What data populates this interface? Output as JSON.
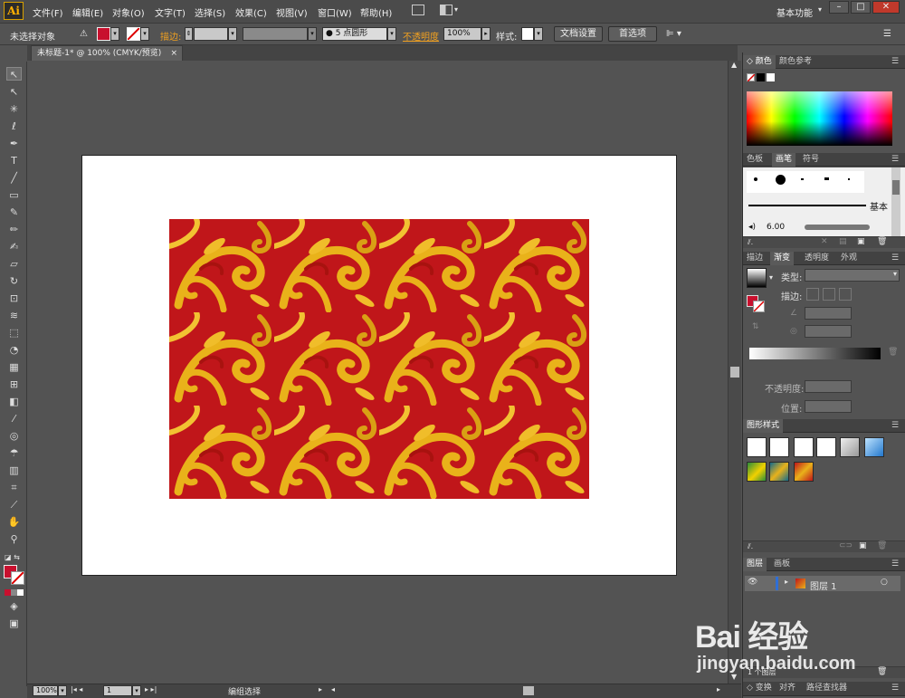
{
  "app": {
    "logo": "Ai",
    "workspace": "基本功能"
  },
  "menu": [
    "文件(F)",
    "编辑(E)",
    "对象(O)",
    "文字(T)",
    "选择(S)",
    "效果(C)",
    "视图(V)",
    "窗口(W)",
    "帮助(H)"
  ],
  "window_controls": {
    "minimize": "–",
    "maximize": "□",
    "close": "✕"
  },
  "control_bar": {
    "selection_status": "未选择对象",
    "stroke_label": "描边:",
    "brush_value": "5 点圆形",
    "opacity_label": "不透明度",
    "opacity_value": "100%",
    "style_label": "样式:",
    "doc_setup_button": "文档设置",
    "prefs_button": "首选项"
  },
  "document_tab": {
    "title": "未标题-1* @ 100% (CMYK/预览)",
    "close": "×"
  },
  "status_bar": {
    "zoom": "100%",
    "artboard_number": "1",
    "status_text": "编组选择"
  },
  "panels": {
    "color": {
      "tabs": [
        "颜色",
        "颜色参考"
      ]
    },
    "brushes": {
      "tabs": [
        "色板",
        "画笔",
        "符号"
      ],
      "basic_label": "基本",
      "brush_size": "6.00"
    },
    "gradient": {
      "tabs": [
        "描边",
        "渐变",
        "透明度",
        "外观"
      ],
      "type_label": "类型:",
      "stroke_label": "描边:",
      "opacity_label": "不透明度:",
      "position_label": "位置:"
    },
    "graphic_styles": {
      "tabs": [
        "图形样式"
      ]
    },
    "layers": {
      "tabs": [
        "图层",
        "画板"
      ],
      "layer_name": "图层 1",
      "footer_count": "1 个图层"
    },
    "bottom_tabs": [
      "变换",
      "对齐",
      "路径查找器"
    ]
  },
  "colors": {
    "fill": "#c8102e",
    "pattern_red": "#c0161a",
    "pattern_gold": "#e9b21a",
    "layer_accent": "#2f6fd6"
  },
  "watermark": {
    "brand": "Bai 经验",
    "url": "jingyan.baidu.com"
  }
}
